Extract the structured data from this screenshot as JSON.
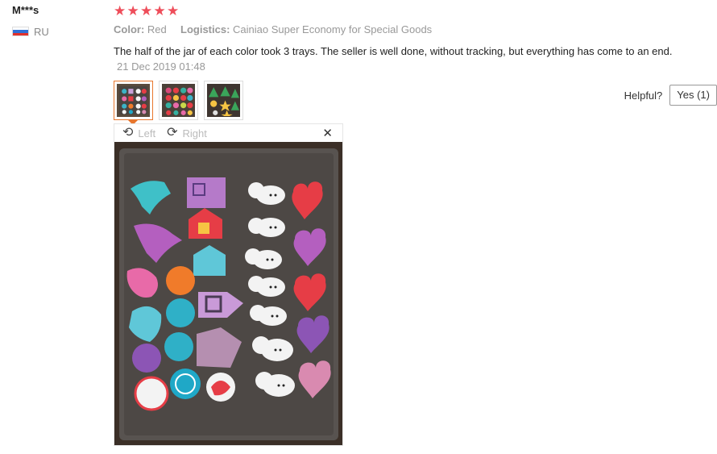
{
  "user": {
    "name": "M***s",
    "country": "RU"
  },
  "review": {
    "rating": 5,
    "color_label": "Color:",
    "color_value": "Red",
    "logistics_label": "Logistics:",
    "logistics_value": "Cainiao Super Economy for Special Goods",
    "text": "The half of the jar of each color took 3 trays. The seller is well done, without tracking, but everything has come to an end.",
    "date": "21 Dec 2019 01:48"
  },
  "photos": {
    "count": 3,
    "active_index": 0
  },
  "helpful": {
    "label": "Helpful?",
    "yes_button": "Yes (1)"
  },
  "viewer": {
    "rotate_left": "Left",
    "rotate_right": "Right"
  },
  "colors": {
    "star": "#ee4d5a",
    "active_thumb_border": "#e8772e"
  }
}
